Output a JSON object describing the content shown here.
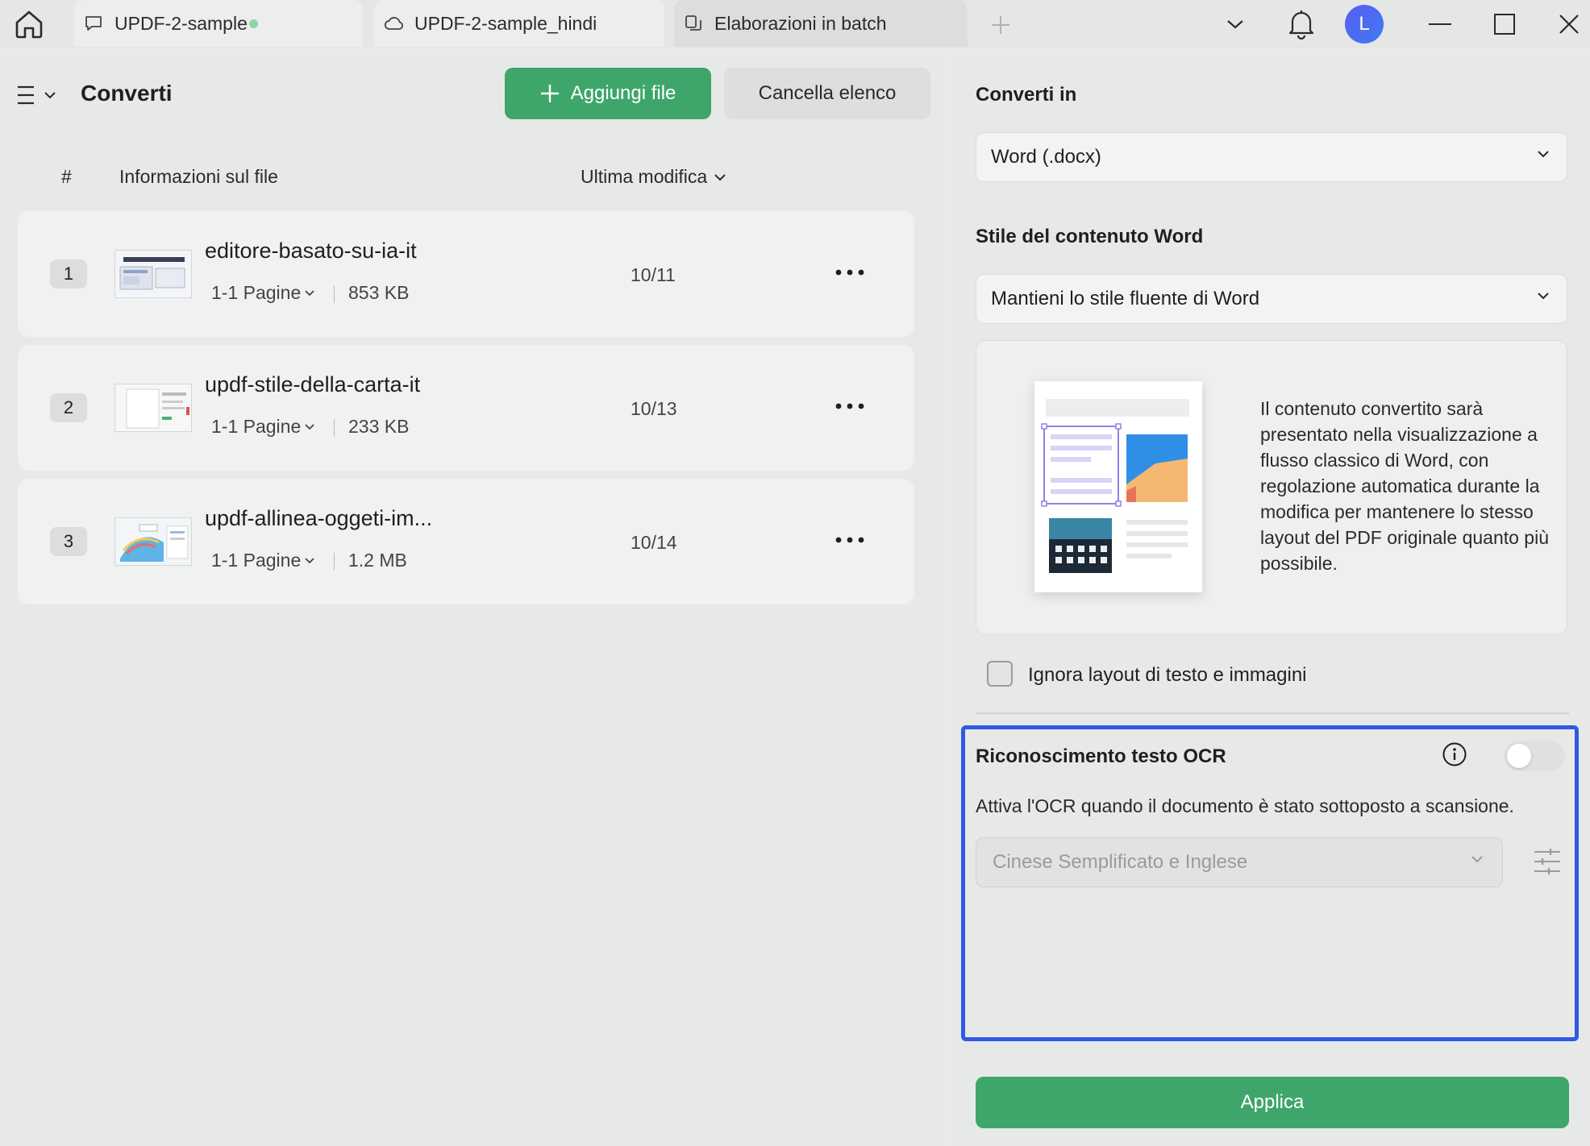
{
  "titlebar": {
    "tabs": [
      {
        "label": "UPDF-2-sample",
        "icon": "comment-icon",
        "unsaved": true
      },
      {
        "label": "UPDF-2-sample_hindi",
        "icon": "cloud-icon"
      },
      {
        "label": "Elaborazioni in batch",
        "icon": "batch-icon",
        "active": true
      }
    ],
    "avatar_letter": "L"
  },
  "left": {
    "title": "Converti",
    "add_button": "Aggiungi file",
    "clear_button": "Cancella elenco",
    "columns": {
      "hash": "#",
      "info": "Informazioni sul file",
      "modified": "Ultima modifica"
    },
    "files": [
      {
        "num": "1",
        "name": "editore-basato-su-ia-it",
        "pages": "1-1 Pagine",
        "size": "853 KB",
        "date": "10/11"
      },
      {
        "num": "2",
        "name": "updf-stile-della-carta-it",
        "pages": "1-1 Pagine",
        "size": "233 KB",
        "date": "10/13"
      },
      {
        "num": "3",
        "name": "updf-allinea-oggeti-im...",
        "pages": "1-1 Pagine",
        "size": "1.2 MB",
        "date": "10/14"
      }
    ]
  },
  "right": {
    "convert_label": "Converti in",
    "format_value": "Word (.docx)",
    "style_label": "Stile del contenuto Word",
    "style_value": "Mantieni lo stile fluente di Word",
    "style_description": "Il contenuto convertito sarà presentato nella visualizzazione a flusso classico di Word, con regolazione automatica durante la modifica per mantenere lo stesso layout del PDF originale quanto più possibile.",
    "ignore_layout_label": "Ignora layout di testo e immagini",
    "ignore_layout_checked": false,
    "ocr": {
      "title": "Riconoscimento testo OCR",
      "enabled": false,
      "description": "Attiva l'OCR quando il documento è stato sottoposto a scansione.",
      "language": "Cinese Semplificato e Inglese"
    },
    "apply_button": "Applica"
  },
  "colors": {
    "accent_green": "#3ea66b",
    "highlight_blue": "#2d5be3",
    "avatar": "#4a6cf2"
  }
}
